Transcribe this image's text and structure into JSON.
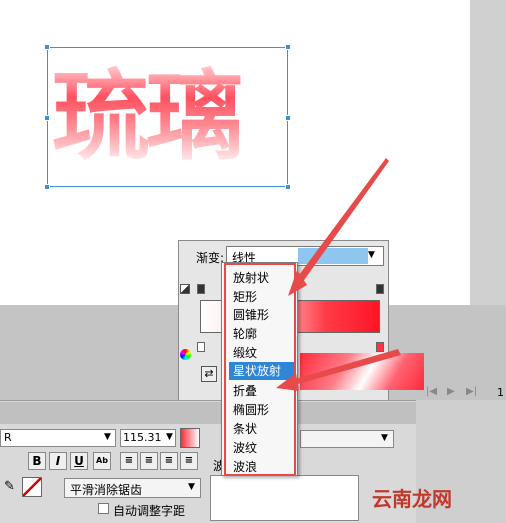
{
  "stage_text": "琉璃",
  "gradient_panel": {
    "label": "渐变:",
    "select_value": "线性"
  },
  "gradient_menu": {
    "items": [
      "放射状",
      "矩形",
      "圆锥形",
      "轮廓",
      "缎纹",
      "星状放射",
      "折叠",
      "椭圆形",
      "条状",
      "波纹",
      "波浪"
    ],
    "highlighted_index": 5
  },
  "properties": {
    "font_name": "R",
    "font_size": "115.31",
    "bold": "B",
    "italic": "I",
    "underline": "U",
    "antialias": "平滑消除锯齿",
    "auto_kern": "自动调整字距",
    "partial_label": "波",
    "right_page_num": "1"
  },
  "watermark": "云南龙网",
  "colors": {
    "selection": "#3d8fd8",
    "highlight": "#2f86d6",
    "annotation_red": "#e64a4a",
    "glass_red": "#ff3c4c"
  }
}
